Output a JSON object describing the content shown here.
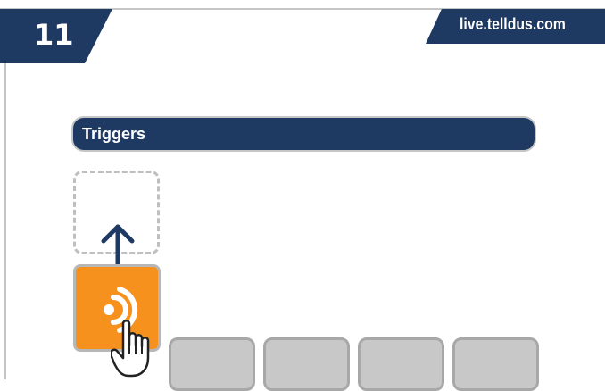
{
  "header": {
    "step_number": "11",
    "site_label": "live.telldus.com"
  },
  "triggers_panel": {
    "title": "Triggers"
  },
  "icons": {
    "arrow": "arrow-up-icon",
    "card": "wireless-signal-icon",
    "cursor": "hand-pointer-icon"
  },
  "colors": {
    "navy": "#1e3a63",
    "orange": "#f6911e",
    "gray_tile": "#c8c8c8",
    "border_gray": "#c6c6c6"
  }
}
